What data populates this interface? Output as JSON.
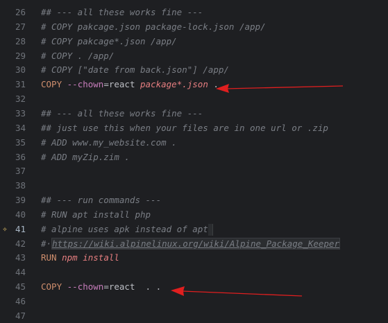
{
  "editor": {
    "lines": [
      {
        "num": "26",
        "tokens": [
          {
            "t": "## --- all these works fine ---",
            "c": "comment"
          }
        ]
      },
      {
        "num": "27",
        "tokens": [
          {
            "t": "# COPY pakcage.json package-lock.json /app/",
            "c": "comment"
          }
        ]
      },
      {
        "num": "28",
        "tokens": [
          {
            "t": "# COPY pakcage*.json /app/",
            "c": "comment"
          }
        ]
      },
      {
        "num": "29",
        "tokens": [
          {
            "t": "# COPY . /app/",
            "c": "comment"
          }
        ]
      },
      {
        "num": "30",
        "tokens": [
          {
            "t": "# COPY [\"date from back.json\"] /app/",
            "c": "comment"
          }
        ]
      },
      {
        "num": "31",
        "tokens": [
          {
            "t": "COPY ",
            "c": "kw"
          },
          {
            "t": "--chown",
            "c": "flag"
          },
          {
            "t": "=react ",
            "c": "plain"
          },
          {
            "t": "package*.json",
            "c": "pathstr"
          },
          {
            "t": " .",
            "c": "plain"
          }
        ]
      },
      {
        "num": "32",
        "tokens": []
      },
      {
        "num": "33",
        "tokens": [
          {
            "t": "## --- all these works fine ---",
            "c": "comment"
          }
        ]
      },
      {
        "num": "34",
        "tokens": [
          {
            "t": "## just use this when your files are in one url or .zip",
            "c": "comment"
          }
        ]
      },
      {
        "num": "35",
        "tokens": [
          {
            "t": "# ADD www.my_website.com .",
            "c": "comment"
          }
        ]
      },
      {
        "num": "36",
        "tokens": [
          {
            "t": "# ADD myZip.zim .",
            "c": "comment"
          }
        ]
      },
      {
        "num": "37",
        "tokens": []
      },
      {
        "num": "38",
        "tokens": []
      },
      {
        "num": "39",
        "tokens": [
          {
            "t": "## --- run commands ---",
            "c": "comment"
          }
        ]
      },
      {
        "num": "40",
        "tokens": [
          {
            "t": "# RUN apt install php",
            "c": "comment"
          }
        ]
      },
      {
        "num": "41",
        "current": true,
        "bulb": true,
        "tokens": [
          {
            "t": "# alpine uses apk instead of apt",
            "c": "comment"
          }
        ]
      },
      {
        "num": "42",
        "tokens": [
          {
            "t": "#·",
            "c": "comment"
          },
          {
            "t": "https://wiki.alpinelinux.org/wiki/Alpine_Package_Keeper",
            "c": "url"
          }
        ]
      },
      {
        "num": "43",
        "tokens": [
          {
            "t": "RUN ",
            "c": "kw"
          },
          {
            "t": "npm install",
            "c": "pathstr"
          }
        ]
      },
      {
        "num": "44",
        "tokens": []
      },
      {
        "num": "45",
        "tokens": [
          {
            "t": "COPY ",
            "c": "kw"
          },
          {
            "t": "--chown",
            "c": "flag"
          },
          {
            "t": "=react  . .",
            "c": "plain"
          }
        ]
      },
      {
        "num": "46",
        "tokens": []
      },
      {
        "num": "47",
        "tokens": []
      }
    ],
    "colors": {
      "background": "#1e1f22",
      "arrow": "#e01f1f",
      "bulb": "#e8c46a"
    }
  }
}
